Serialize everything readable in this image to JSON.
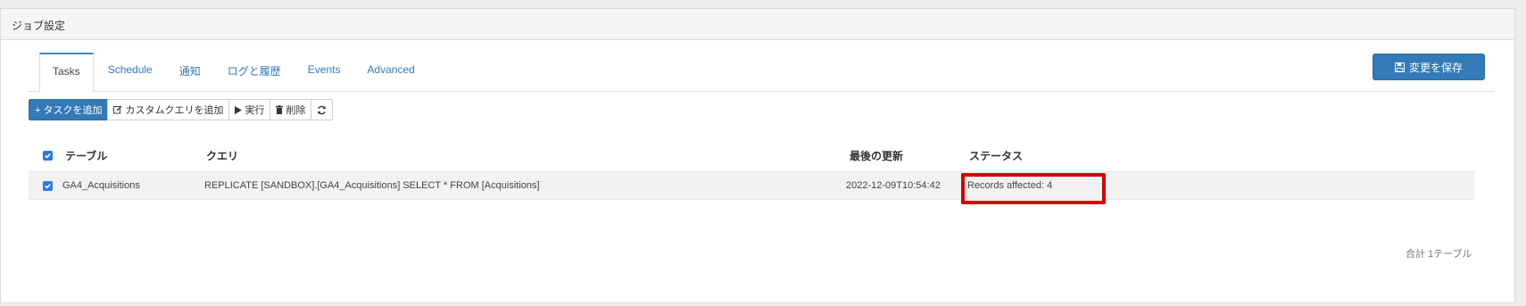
{
  "panel": {
    "title": "ジョブ設定"
  },
  "tabs": [
    {
      "label": "Tasks",
      "active": true
    },
    {
      "label": "Schedule",
      "active": false
    },
    {
      "label": "通知",
      "active": false
    },
    {
      "label": "ログと履歴",
      "active": false
    },
    {
      "label": "Events",
      "active": false
    },
    {
      "label": "Advanced",
      "active": false
    }
  ],
  "save_button": {
    "label": "変更を保存",
    "icon": "floppy-disk-icon"
  },
  "toolbar": {
    "add_task": "+ タスクを追加",
    "add_custom_query": "カスタムクエリを追加",
    "run": "実行",
    "delete": "削除",
    "refresh_icon": "refresh-icon"
  },
  "table": {
    "columns": [
      "テーブル",
      "クエリ",
      "最後の更新",
      "ステータス"
    ],
    "rows": [
      {
        "checked": true,
        "table": "GA4_Acquisitions",
        "query": "REPLICATE [SANDBOX].[GA4_Acquisitions] SELECT * FROM [Acquisitions]",
        "last_updated": "2022-12-09T10:54:42",
        "status": "Records affected: 4"
      }
    ]
  },
  "footer": {
    "total_label": "合計",
    "count_label": "1テーブル"
  },
  "colors": {
    "primary": "#337ab7",
    "highlight": "#d50000",
    "checkbox": "#2a7ae2"
  }
}
